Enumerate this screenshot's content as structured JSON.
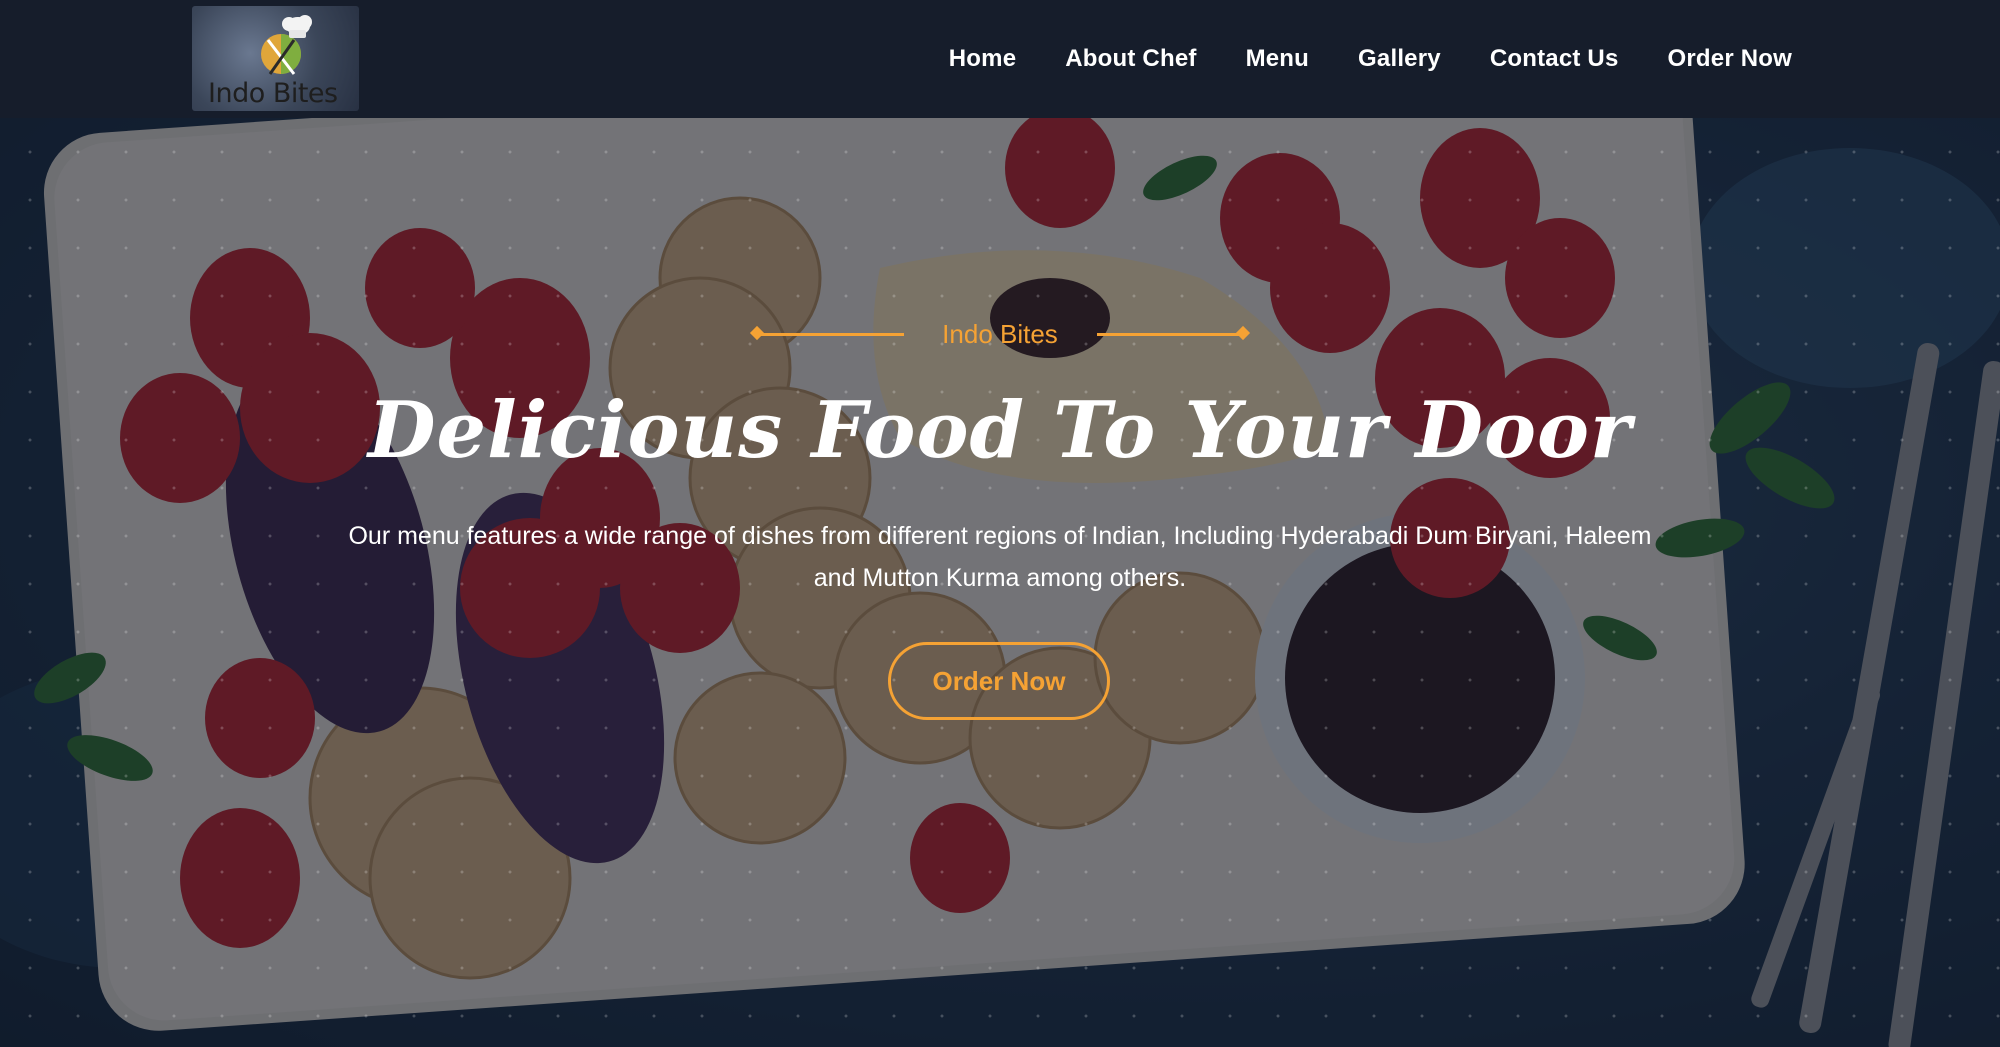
{
  "brand": {
    "logo_text": "Indo Bites"
  },
  "nav": {
    "items": [
      {
        "label": "Home"
      },
      {
        "label": "About Chef"
      },
      {
        "label": "Menu"
      },
      {
        "label": "Gallery"
      },
      {
        "label": "Contact Us"
      },
      {
        "label": "Order Now"
      }
    ]
  },
  "hero": {
    "eyebrow": "Indo Bites",
    "title": "Delicious Food To Your Door",
    "description": "Our menu features a wide range of dishes from different regions of Indian, Including Hyderabadi Dum Biryani, Haleem and Mutton Kurma among others.",
    "cta_label": "Order Now"
  },
  "colors": {
    "accent": "#f5a234",
    "header_bg": "#161d2b",
    "text": "#ffffff"
  }
}
